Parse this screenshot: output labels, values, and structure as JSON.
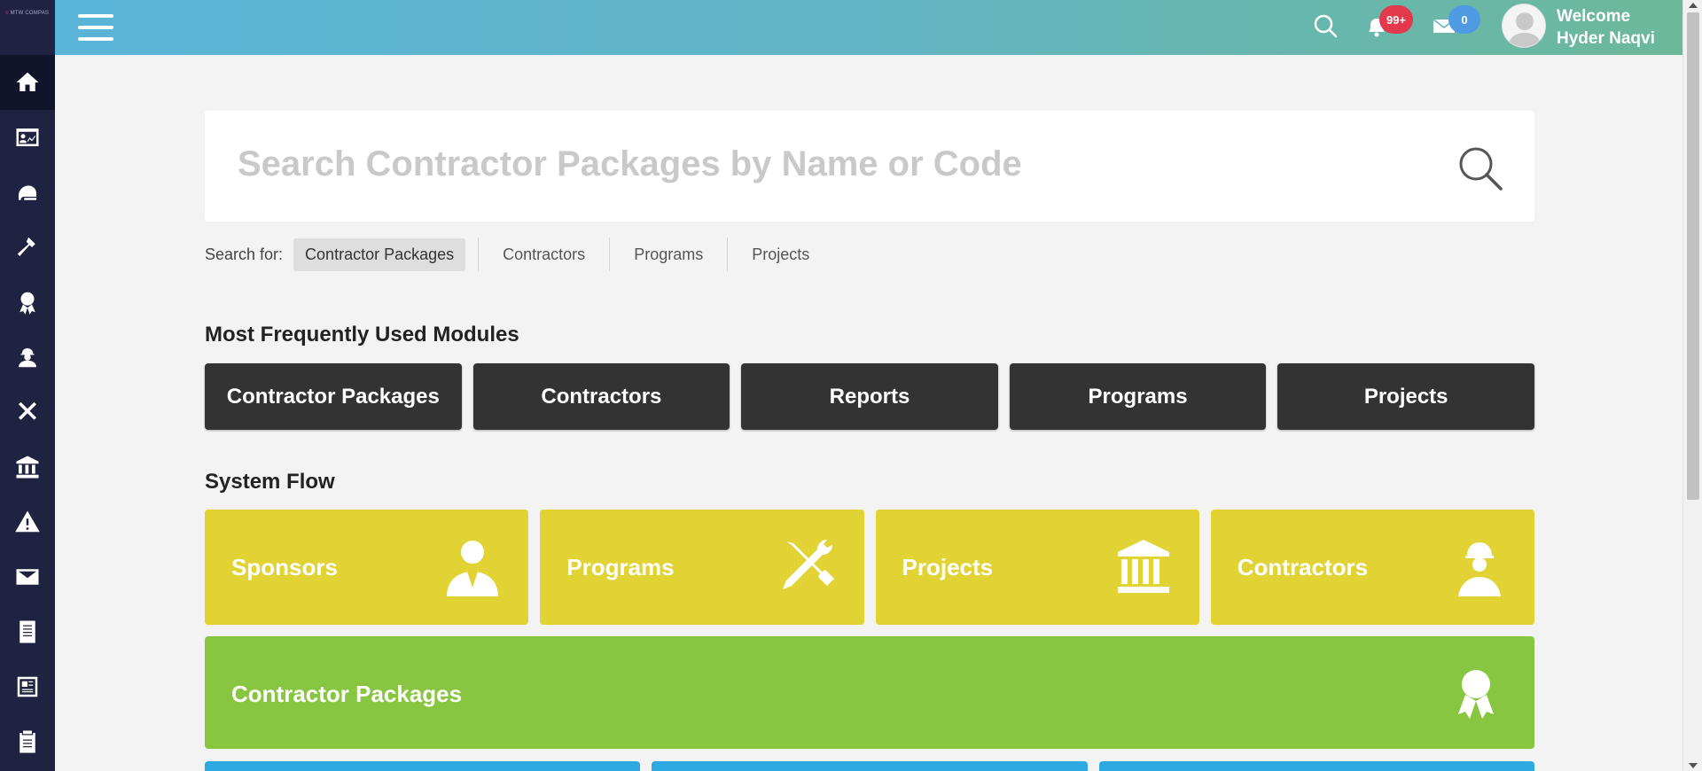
{
  "app": {
    "logo_text": "MTW COMPAS"
  },
  "header": {
    "notifications_count": "99+",
    "messages_count": "0",
    "welcome_line1": "Welcome",
    "welcome_line2": "Hyder Naqvi"
  },
  "sidebar": {
    "items": [
      {
        "icon": "home-icon",
        "active": true
      },
      {
        "icon": "dashboard-chart-icon"
      },
      {
        "icon": "helmet-icon"
      },
      {
        "icon": "hammer-icon"
      },
      {
        "icon": "award-ribbon-icon"
      },
      {
        "icon": "worker-icon"
      },
      {
        "icon": "tools-icon"
      },
      {
        "icon": "bank-icon"
      },
      {
        "icon": "warning-icon"
      },
      {
        "icon": "mail-icon"
      },
      {
        "icon": "document-icon"
      },
      {
        "icon": "newspaper-icon"
      },
      {
        "icon": "clipboard-icon"
      }
    ]
  },
  "search": {
    "placeholder": "Search Contractor Packages by Name or Code",
    "for_label": "Search for:",
    "options": [
      "Contractor Packages",
      "Contractors",
      "Programs",
      "Projects"
    ],
    "active_option": "Contractor Packages"
  },
  "modules": {
    "title": "Most Frequently Used Modules",
    "items": [
      "Contractor Packages",
      "Contractors",
      "Reports",
      "Programs",
      "Projects"
    ]
  },
  "flow": {
    "title": "System Flow",
    "cards": [
      {
        "label": "Sponsors",
        "icon": "sponsor-person-icon"
      },
      {
        "label": "Programs",
        "icon": "tools-icon"
      },
      {
        "label": "Projects",
        "icon": "bank-icon"
      },
      {
        "label": "Contractors",
        "icon": "worker-icon"
      }
    ],
    "wide": {
      "label": "Contractor Packages",
      "icon": "award-ribbon-icon"
    }
  },
  "colors": {
    "sidebar": "#1f2240",
    "yellow_card": "#e1d333",
    "green_card": "#88c540",
    "blue_card": "#2ea8e0",
    "module_btn": "#333333"
  }
}
